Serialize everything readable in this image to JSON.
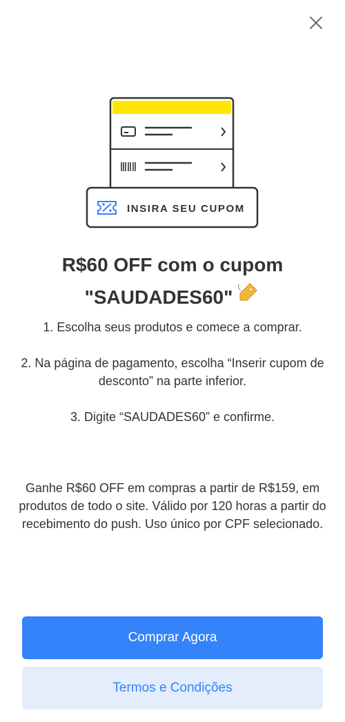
{
  "modal": {
    "close_icon": "close-icon"
  },
  "illustration": {
    "coupon_label": "INSIRA SEU CUPOM",
    "accent_color": "#FFE600",
    "icons": [
      "card-icon",
      "barcode-icon",
      "chevron-right-icon",
      "coupon-percent-icon"
    ]
  },
  "title": {
    "line1": "R$60 OFF com o cupom",
    "line2": "\"SAUDADES60\"",
    "icon": "tag-icon"
  },
  "steps": [
    "1. Escolha seus produtos e comece a comprar.",
    "2. Na página de pagamento, escolha “Inserir cupom de desconto” na parte inferior.",
    "3. Digite “SAUDADES60” e confirme."
  ],
  "details": "Ganhe R$60 OFF em compras a partir de R$159, em produtos de todo o site. Válido por 120 horas a partir do recebimento do push. Uso único por CPF selecionado.",
  "buttons": {
    "primary_label": "Comprar Agora",
    "secondary_label": "Termos e Condições"
  },
  "colors": {
    "primary": "#3483FA",
    "secondary_bg": "#E3EDFB",
    "text": "#333333"
  }
}
